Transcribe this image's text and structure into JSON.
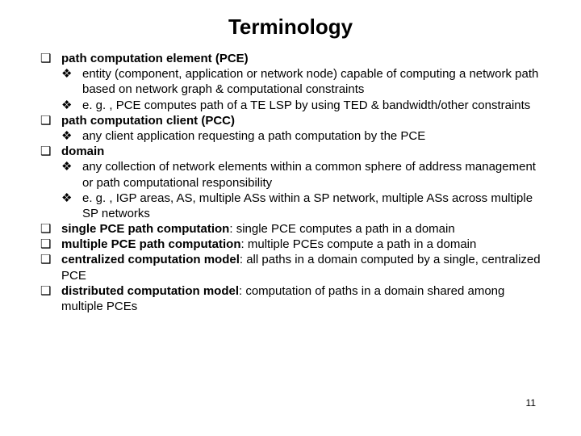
{
  "title": "Terminology",
  "page_number": "11",
  "items": {
    "i0_pre": "path computation element (PCE)",
    "i0a": "entity (component, application or network node) capable of computing a network path based on network graph & computational constraints",
    "i0b": "e. g. , PCE computes path of a TE LSP by using TED & bandwidth/other constraints",
    "i1_pre": "path computation client (PCC)",
    "i1a": "any client application requesting a path computation by the PCE",
    "i2_pre": "domain",
    "i2a": " any collection of network elements within a common sphere of address management or path computational responsibility",
    "i2b": "e. g. , IGP areas, AS, multiple ASs within a SP network, multiple ASs across multiple SP networks",
    "i3_pre": "single PCE path computation",
    "i3_post": ": single PCE computes a path in a domain",
    "i4_pre": "multiple PCE path computation",
    "i4_post": ": multiple PCEs compute a path in a domain",
    "i5_pre": "centralized computation model",
    "i5_post": ": all paths in a domain computed by a single, centralized PCE",
    "i6_pre": "distributed computation model",
    "i6_post": ": computation of paths in a domain shared among multiple PCEs"
  }
}
